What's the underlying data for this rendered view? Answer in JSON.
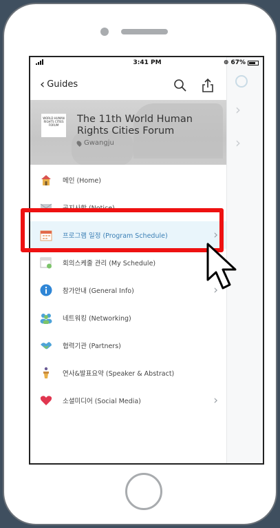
{
  "status_bar": {
    "time": "3:41 PM",
    "battery": "67%"
  },
  "nav": {
    "back_label": "Guides"
  },
  "event": {
    "logo_text": "WORLD HUMAN RIGHTS CITIES FORUM",
    "title": "The 11th World Human Rights Cities Forum",
    "location": "Gwangju"
  },
  "menu": [
    {
      "label": "메인 (Home)",
      "icon": "home-icon",
      "chevron": false
    },
    {
      "label": "공지사항 (Notice)",
      "icon": "envelope-icon",
      "chevron": false
    },
    {
      "label": "프로그램 일정 (Program Schedule)",
      "icon": "calendar-icon",
      "chevron": true
    },
    {
      "label": "회의스케줄 관리 (My Schedule)",
      "icon": "schedule-icon",
      "chevron": false
    },
    {
      "label": "참가안내 (General Info)",
      "icon": "info-icon",
      "chevron": true
    },
    {
      "label": "네트워킹 (Networking)",
      "icon": "people-icon",
      "chevron": false
    },
    {
      "label": "협력기관 (Partners)",
      "icon": "handshake-icon",
      "chevron": false
    },
    {
      "label": "연사&발표요약 (Speaker & Abstract)",
      "icon": "podium-icon",
      "chevron": false
    },
    {
      "label": "소셜미디어 (Social Media)",
      "icon": "heart-icon",
      "chevron": true
    }
  ],
  "colors": {
    "highlight": "#ee1111",
    "accent": "#3a7fb5",
    "background": "#3f4f5f"
  }
}
